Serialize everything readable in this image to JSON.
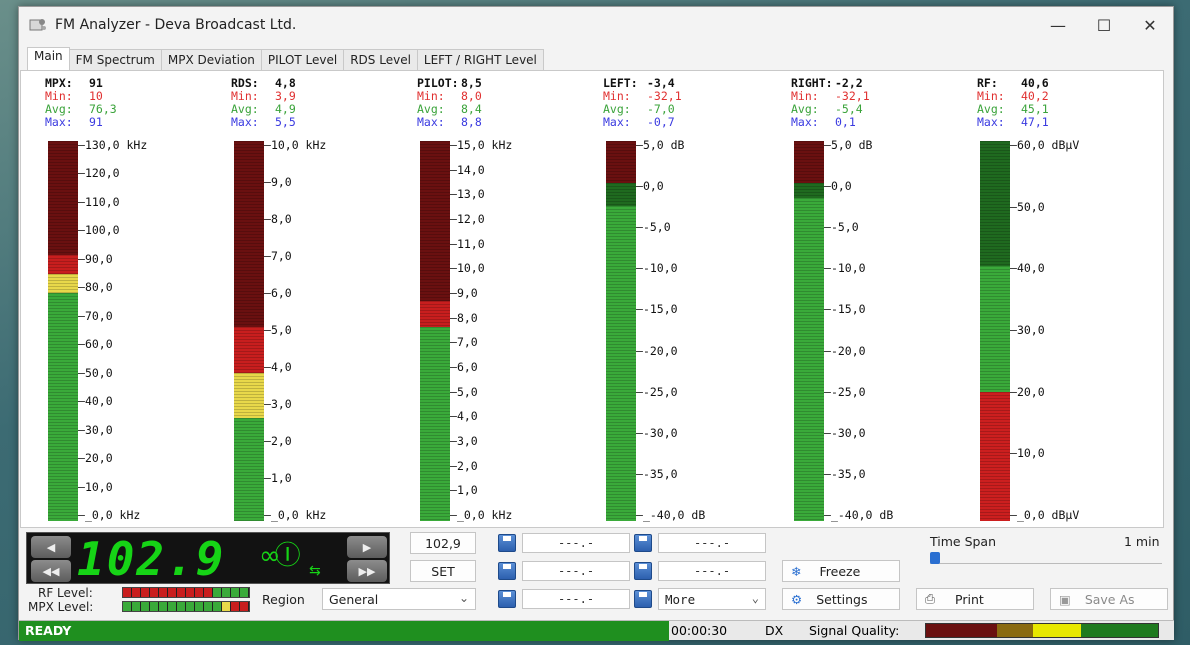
{
  "window": {
    "title": "FM Analyzer - Deva Broadcast Ltd.",
    "minimize": "—",
    "maximize": "☐",
    "close": "✕"
  },
  "tabs": [
    "Main",
    "FM Spectrum",
    "MPX Deviation",
    "PILOT Level",
    "RDS Level",
    "LEFT / RIGHT Level"
  ],
  "meters": [
    {
      "name": "MPX",
      "head": "MPX:",
      "value": "91",
      "min": "10",
      "avg": "76,3",
      "max": "91",
      "ticks": [
        "130,0 kHz",
        "120,0",
        "110,0",
        "100,0",
        "90,0",
        "80,0",
        "70,0",
        "60,0",
        "50,0",
        "40,0",
        "30,0",
        "20,0",
        "10,0",
        "_0,0 kHz"
      ],
      "segments": [
        {
          "color": "#3aaa3a",
          "from": 0,
          "to": 0.6
        },
        {
          "color": "#e8d84a",
          "from": 0.6,
          "to": 0.65
        },
        {
          "color": "#c81e1e",
          "from": 0.65,
          "to": 0.7
        },
        {
          "color": "#6a1010",
          "from": 0.7,
          "to": 1.0
        }
      ]
    },
    {
      "name": "RDS",
      "head": "RDS:",
      "value": "4,8",
      "min": "3,9",
      "avg": "4,9",
      "max": "5,5",
      "ticks": [
        "10,0 kHz",
        "9,0",
        "8,0",
        "7,0",
        "6,0",
        "5,0",
        "4,0",
        "3,0",
        "2,0",
        "1,0",
        "_0,0 kHz"
      ],
      "segments": [
        {
          "color": "#3aaa3a",
          "from": 0,
          "to": 0.27
        },
        {
          "color": "#e8d84a",
          "from": 0.27,
          "to": 0.39
        },
        {
          "color": "#c81e1e",
          "from": 0.39,
          "to": 0.51
        },
        {
          "color": "#6a1010",
          "from": 0.51,
          "to": 1.0
        }
      ]
    },
    {
      "name": "PILOT",
      "head": "PILOT:",
      "value": "8,5",
      "min": "8,0",
      "avg": "8,4",
      "max": "8,8",
      "ticks": [
        "15,0 kHz",
        "14,0",
        "13,0",
        "12,0",
        "11,0",
        "10,0",
        "9,0",
        "8,0",
        "7,0",
        "6,0",
        "5,0",
        "4,0",
        "3,0",
        "2,0",
        "1,0",
        "_0,0 kHz"
      ],
      "segments": [
        {
          "color": "#3aaa3a",
          "from": 0,
          "to": 0.51
        },
        {
          "color": "#c81e1e",
          "from": 0.51,
          "to": 0.58
        },
        {
          "color": "#6a1010",
          "from": 0.58,
          "to": 1.0
        }
      ]
    },
    {
      "name": "LEFT",
      "head": "LEFT:",
      "value": "-3,4",
      "min": "-32,1",
      "avg": "-7,0",
      "max": "-0,7",
      "ticks": [
        "5,0 dB",
        "0,0",
        "-5,0",
        "-10,0",
        "-15,0",
        "-20,0",
        "-25,0",
        "-30,0",
        "-35,0",
        "_-40,0 dB"
      ],
      "segments": [
        {
          "color": "#3aaa3a",
          "from": 0,
          "to": 0.83
        },
        {
          "color": "#1f6a1f",
          "from": 0.83,
          "to": 0.89
        },
        {
          "color": "#6a1010",
          "from": 0.89,
          "to": 1.0
        }
      ]
    },
    {
      "name": "RIGHT",
      "head": "RIGHT:",
      "value": "-2,2",
      "min": "-32,1",
      "avg": "-5,4",
      "max": "0,1",
      "ticks": [
        "5,0 dB",
        "0,0",
        "-5,0",
        "-10,0",
        "-15,0",
        "-20,0",
        "-25,0",
        "-30,0",
        "-35,0",
        "_-40,0 dB"
      ],
      "segments": [
        {
          "color": "#3aaa3a",
          "from": 0,
          "to": 0.85
        },
        {
          "color": "#1f6a1f",
          "from": 0.85,
          "to": 0.89
        },
        {
          "color": "#6a1010",
          "from": 0.89,
          "to": 1.0
        }
      ]
    },
    {
      "name": "RF",
      "head": "RF:",
      "value": "40,6",
      "min": "40,2",
      "avg": "45,1",
      "max": "47,1",
      "ticks": [
        "60,0 dBµV",
        "50,0",
        "40,0",
        "30,0",
        "20,0",
        "10,0",
        "_0,0 dBµV"
      ],
      "segments": [
        {
          "color": "#cc1f1f",
          "from": 0,
          "to": 0.34
        },
        {
          "color": "#3aaa3a",
          "from": 0.34,
          "to": 0.67
        },
        {
          "color": "#1f6a1f",
          "from": 0.67,
          "to": 1.0
        }
      ]
    }
  ],
  "stat_labels": {
    "min": "Min:",
    "avg": "Avg:",
    "max": "Max:"
  },
  "display": {
    "frequency": "102.9",
    "stereo": "∞Ⓘ",
    "usb": "⇆"
  },
  "controls": {
    "freq_field": "102,9",
    "set_button": "SET",
    "mem_placeholder": "---.-",
    "more_select": "More",
    "freeze_button": "Freeze",
    "settings_button": "Settings",
    "print_button": "Print",
    "saveas_button": "Save As",
    "time_span_label": "Time Span",
    "time_span_value": "1 min",
    "region_label": "Region",
    "region_value": "General",
    "rf_level_label": "RF Level:",
    "mpx_level_label": "MPX Level:"
  },
  "status": {
    "state": "READY",
    "time": "00:00:30",
    "mode": "DX",
    "signal_quality_label": "Signal Quality:"
  }
}
